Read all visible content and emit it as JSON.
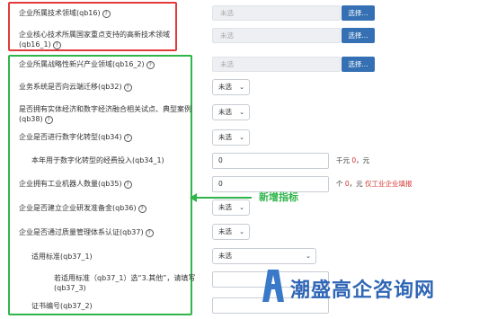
{
  "rows": [
    {
      "label": "企业所属技术领域(qb16)",
      "value": "未选",
      "button": "选择..."
    },
    {
      "label": "企业核心技术所属国家重点支持的高新技术领域(qb16_1)",
      "value": "未选",
      "button": "选择..."
    },
    {
      "label": "企业所属战略性新兴产业领域(qb16_2)",
      "value": "未选",
      "button": "选择..."
    },
    {
      "label": "业务系统是否向云端迁移(qb32)",
      "value": "未选"
    },
    {
      "label": "是否拥有实体经济和数字经济融合相关试点、典型案例(qb38)",
      "value": "未选"
    },
    {
      "label": "企业是否进行数字化转型(qb34)",
      "value": "未选"
    },
    {
      "label": "本年用于数字化转型的经费投入(qb34_1)",
      "value": "0",
      "unit_prefix": "千元 ",
      "unit_red": "0",
      "unit_suffix": "，元"
    },
    {
      "label": "企业拥有工业机器人数量(qb35)",
      "value": "0",
      "unit_prefix": "个 ",
      "unit_red": "0",
      "unit_suffix": "，元",
      "note": " 仅工业企业填报"
    },
    {
      "label": "企业是否建立企业研发准备金(qb36)",
      "value": "未选"
    },
    {
      "label": "企业是否通过质量管理体系认证(qb37)",
      "value": "未选"
    },
    {
      "label": "适用标准(qb37_1)",
      "value": "未选"
    },
    {
      "label": "若适用标准（qb37_1）选“3.其他”，请填写(qb37_3)",
      "value": ""
    },
    {
      "label": "证书编号(qb37_2)",
      "value": ""
    }
  ],
  "annotation": {
    "text": "新增指标",
    "color": "#2fb54a"
  },
  "watermark": {
    "text": "潮盛高企咨询网",
    "color": "#2f66b5"
  },
  "colors": {
    "red_box": "#e23a3a",
    "green_box": "#2fb54a",
    "button": "#3470b3"
  },
  "icons": {
    "help": "question-circle-icon",
    "dropdown": "chevron-down-icon"
  }
}
